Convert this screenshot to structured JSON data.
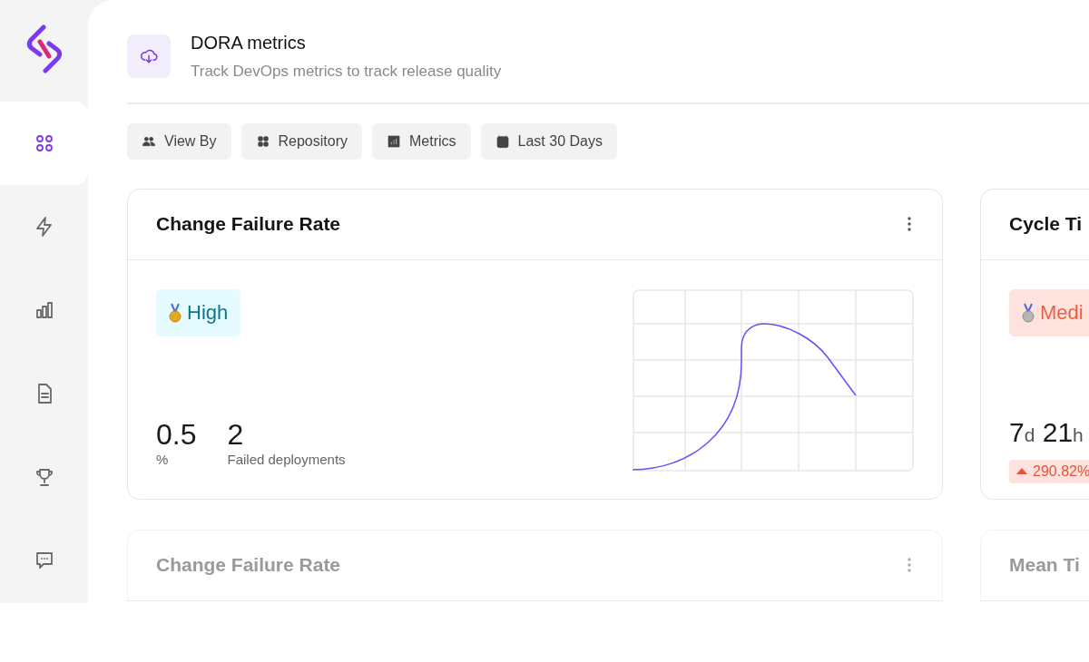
{
  "sidebar": {
    "items": [
      {
        "selected": true
      },
      {
        "selected": false
      },
      {
        "selected": false
      },
      {
        "selected": false
      },
      {
        "selected": false
      },
      {
        "selected": false
      }
    ]
  },
  "header": {
    "title": "DORA metrics",
    "subtitle": "Track DevOps metrics to track release quality"
  },
  "filters": [
    {
      "label": "View By"
    },
    {
      "label": "Repository"
    },
    {
      "label": "Metrics"
    },
    {
      "label": "Last 30 Days"
    }
  ],
  "cards": [
    {
      "title": "Change Failure Rate",
      "faded": false,
      "badge": {
        "kind": "high",
        "label": "High"
      },
      "stats": [
        {
          "value": "0.5",
          "caption": "%"
        },
        {
          "value": "2",
          "caption": "Failed deployments"
        }
      ]
    },
    {
      "title": "Cycle Ti",
      "faded": false,
      "badge": {
        "kind": "medium",
        "label": "Medi"
      },
      "duration": [
        {
          "number": "7",
          "unit": "d"
        },
        {
          "number": "21",
          "unit": "h"
        }
      ],
      "change": "290.82%"
    },
    {
      "title": "Change Failure Rate",
      "faded": true
    },
    {
      "title": "Mean Ti",
      "faded": true
    }
  ]
}
